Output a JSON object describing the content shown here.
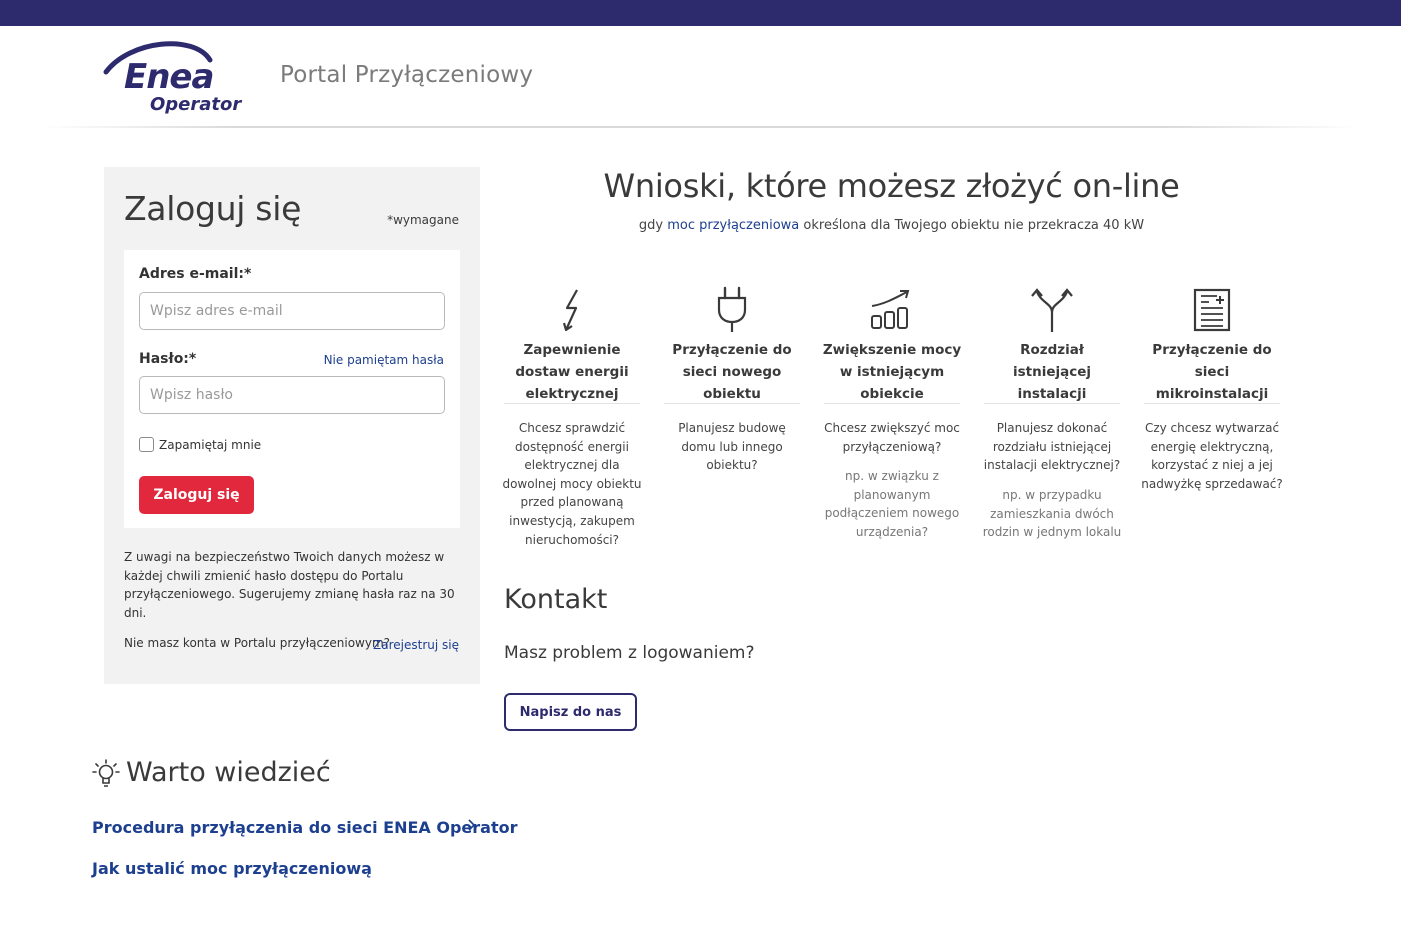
{
  "header": {
    "logo_main": "Enea",
    "logo_sub": "Operator",
    "portal_title": "Portal Przyłączeniowy"
  },
  "login": {
    "title": "Zaloguj się",
    "required_note": "*wymagane",
    "email_label": "Adres e-mail:*",
    "email_placeholder": "Wpisz adres e-mail",
    "password_label": "Hasło:*",
    "forgot_link": "Nie pamiętam hasła",
    "password_placeholder": "Wpisz hasło",
    "remember_label": "Zapamiętaj mnie",
    "submit_label": "Zaloguj się",
    "security_note": "Z uwagi na bezpieczeństwo Twoich danych możesz w każdej chwili zmienić hasło dostępu do Portalu przyłączeniowego. Sugerujemy zmianę hasła raz na 30 dni.",
    "no_account": "Nie masz konta w Portalu przyłączeniowym?",
    "register_link": "Zarejestruj się"
  },
  "main": {
    "heading": "Wnioski, które możesz złożyć on-line",
    "sub_prefix": "gdy ",
    "sub_highlight": "moc przyłączeniowa",
    "sub_suffix": " określona dla Twojego obiektu nie przekracza 40 kW",
    "services": [
      {
        "icon": "lightning-icon",
        "title": "Zapewnienie dostaw energii elektrycznej",
        "desc": "Chcesz sprawdzić dostępność energii elektrycznej dla dowolnej mocy obiektu przed planowaną inwestycją, zakupem nieruchomości?",
        "note": ""
      },
      {
        "icon": "plug-icon",
        "title": "Przyłączenie do sieci nowego obiektu",
        "desc": "Planujesz budowę domu lub innego obiektu?",
        "note": ""
      },
      {
        "icon": "growth-chart-icon",
        "title": "Zwiększenie mocy w istniejącym obiekcie",
        "desc": "Chcesz zwiększyć moc przyłączeniową?",
        "note": "np. w związku z planowanym podłączeniem nowego urządzenia?"
      },
      {
        "icon": "split-arrows-icon",
        "title": "Rozdział istniejącej instalacji",
        "desc": "Planujesz dokonać rozdziału istniejącej instalacji elektrycznej?",
        "note": "np. w przypadku zamieszkania dwóch rodzin w jednym lokalu"
      },
      {
        "icon": "document-icon",
        "title": "Przyłączenie do sieci mikroinstalacji",
        "desc": "Czy chcesz wytwarzać energię elektryczną, korzystać z niej a jej nadwyżkę sprzedawać?",
        "note": ""
      }
    ]
  },
  "contact": {
    "title": "Kontakt",
    "subtitle": "Masz problem z logowaniem?",
    "button": "Napisz do nas"
  },
  "info": {
    "title": "Warto wiedzieć",
    "links": [
      "Procedura przyłączenia do sieci ENEA Operator",
      "Jak ustalić moc przyłączeniową"
    ]
  },
  "colors": {
    "brand": "#2d2a6e",
    "accent_red": "#e1283d",
    "link": "#1d3f8f"
  }
}
